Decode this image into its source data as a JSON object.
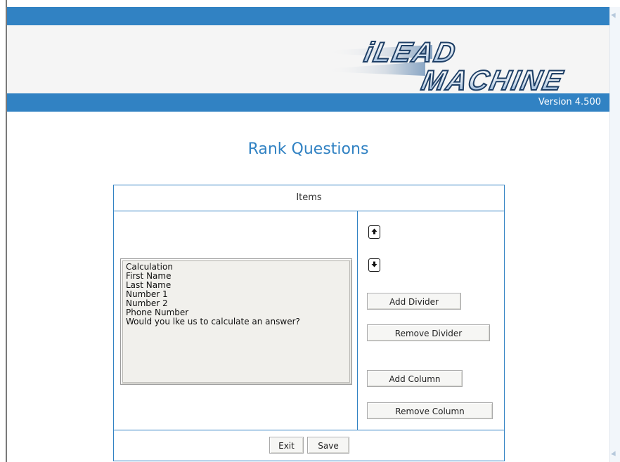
{
  "header": {
    "logo_alt": "iLead Machine",
    "version_label": "Version 4.500"
  },
  "page": {
    "title": "Rank Questions"
  },
  "panel": {
    "heading": "Items",
    "items": [
      "Calculation",
      "First Name",
      "Last Name",
      "Number 1",
      "Number 2",
      "Phone Number",
      "Would you lke us to calculate an answer?"
    ],
    "buttons": {
      "add_divider": "Add Divider",
      "remove_divider": "Remove Divider",
      "add_column": "Add Column",
      "remove_column": "Remove Column"
    }
  },
  "footer": {
    "exit_label": "Exit",
    "save_label": "Save"
  },
  "colors": {
    "accent": "#3182c3",
    "header_bg": "#f5f5f5",
    "list_bg": "#f1f0ec"
  },
  "icons": [
    "move-up-icon",
    "move-down-icon",
    "scroll-up-icon",
    "scroll-down-icon"
  ]
}
